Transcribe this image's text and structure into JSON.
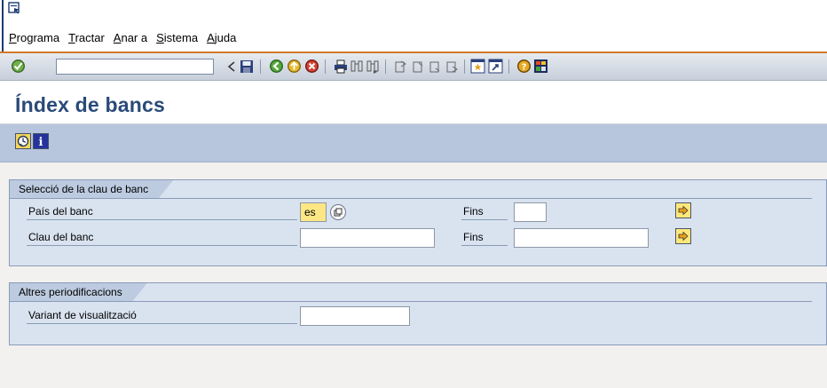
{
  "menu": {
    "items": [
      {
        "first": "P",
        "rest": "rograma"
      },
      {
        "first": "T",
        "rest": "ractar"
      },
      {
        "first": "A",
        "rest": "nar a"
      },
      {
        "first": "S",
        "rest": "istema"
      },
      {
        "first": "A",
        "rest": "juda"
      }
    ]
  },
  "toolbar": {
    "command_value": "",
    "icons": [
      "enter-icon",
      "command-field-dropdown-icon",
      "back-icon",
      "save-icon",
      "back-navigation-icon",
      "exit-icon",
      "cancel-icon",
      "print-icon",
      "find-icon",
      "find-next-icon",
      "first-page-icon",
      "previous-page-icon",
      "next-page-icon",
      "last-page-icon",
      "create-session-icon",
      "shortcut-icon",
      "help-icon",
      "customize-layout-icon"
    ]
  },
  "page": {
    "title": "Índex de bancs"
  },
  "app_toolbar": {
    "icons": [
      "execute-icon",
      "info-icon"
    ]
  },
  "group1": {
    "title": "Selecció de la clau de banc",
    "rows": [
      {
        "label": "País del banc",
        "value": "es",
        "to_label": "Fins",
        "to_value": ""
      },
      {
        "label": "Clau del banc",
        "value": "",
        "to_label": "Fins",
        "to_value": ""
      }
    ]
  },
  "group2": {
    "title": "Altres periodificacions",
    "rows": [
      {
        "label": "Variant de visualització",
        "value": ""
      }
    ]
  },
  "colors": {
    "accent_orange": "#d07b2a",
    "title_blue": "#2a4a79",
    "group_bg": "#d9e3f0",
    "app_toolbar_bg": "#b7c6dc",
    "required_field": "#fde785"
  }
}
